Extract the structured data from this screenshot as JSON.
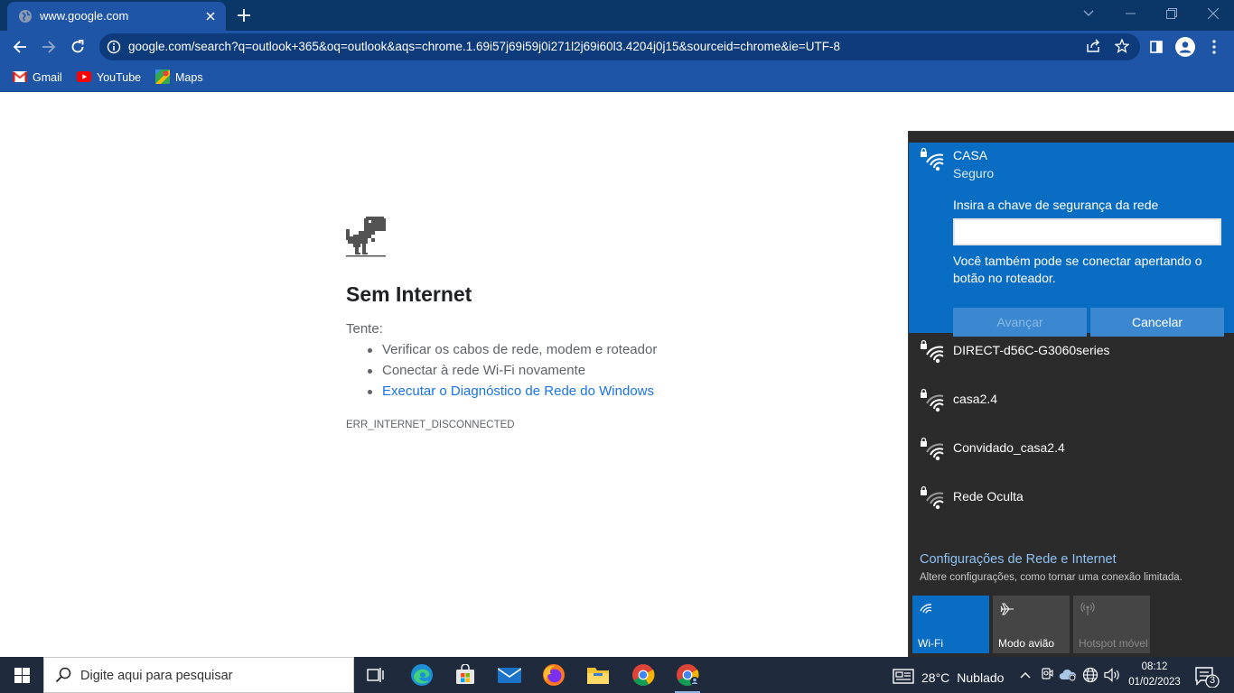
{
  "browser": {
    "tab": {
      "title": "www.google.com"
    },
    "url": "google.com/search?q=outlook+365&oq=outlook&aqs=chrome.1.69i57j69i59j0i271l2j69i60l3.4204j0j15&sourceid=chrome&ie=UTF-8",
    "bookmarks": [
      {
        "label": "Gmail",
        "icon": "gmail-icon"
      },
      {
        "label": "YouTube",
        "icon": "youtube-icon"
      },
      {
        "label": "Maps",
        "icon": "maps-icon"
      }
    ],
    "colors": {
      "frame": "#0b3768",
      "toolbar": "#1f55a6",
      "omnibox": "#0d3b7c"
    }
  },
  "error_page": {
    "icon": "dinosaur-icon",
    "title": "Sem Internet",
    "try_label": "Tente:",
    "suggestions": [
      "Verificar os cabos de rede, modem e roteador",
      "Conectar à rede Wi-Fi novamente",
      "Executar o Diagnóstico de Rede do Windows"
    ],
    "code": "ERR_INTERNET_DISCONNECTED"
  },
  "network_flyout": {
    "selected": {
      "name": "CASA",
      "status": "Seguro",
      "key_label": "Insira a chave de segurança da rede",
      "key_value": "",
      "hint": "Você também pode se conectar apertando o botão no roteador.",
      "next_label": "Avançar",
      "cancel_label": "Cancelar"
    },
    "networks": [
      {
        "name": "DIRECT-d56C-G3060series"
      },
      {
        "name": "casa2.4"
      },
      {
        "name": "Convidado_casa2.4"
      },
      {
        "name": "Rede Oculta"
      }
    ],
    "settings_link": "Configurações de Rede e Internet",
    "settings_desc": "Altere configurações, como tornar uma conexão limitada.",
    "quick_actions": [
      {
        "label": "Wi-Fi",
        "icon": "wifi-icon",
        "state": "on"
      },
      {
        "label": "Modo avião",
        "icon": "airplane-icon",
        "state": "off"
      },
      {
        "label": "Hotspot móvel",
        "icon": "hotspot-icon",
        "state": "disabled"
      }
    ],
    "accent": "#0a6dc4"
  },
  "taskbar": {
    "search_placeholder": "Digite aqui para pesquisar",
    "apps": [
      "task-view-icon",
      "edge-icon",
      "store-icon",
      "mail-icon",
      "firefox-icon",
      "file-explorer-icon",
      "chrome-icon",
      "chrome-profile-icon"
    ],
    "weather": {
      "temp": "28°C",
      "condition": "Nublado"
    },
    "time": "08:12",
    "date": "01/02/2023",
    "notifications": "3"
  }
}
